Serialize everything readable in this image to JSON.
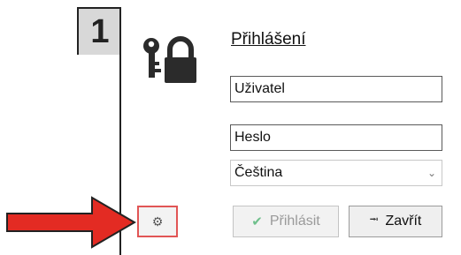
{
  "step_badge": "1",
  "dialog": {
    "title": "Přihlášení",
    "username_placeholder": "Uživatel",
    "password_placeholder": "Heslo",
    "language_selected": "Čeština",
    "login_label": "Přihlásit",
    "close_label": "Zavřít"
  },
  "icons": {
    "header": "key-lock-icon",
    "settings": "gear-icon",
    "login": "checkmark-icon",
    "close": "exit-door-icon",
    "dropdown": "chevron-down-icon",
    "annotation": "red-arrow"
  },
  "colors": {
    "annotation_arrow": "#e32b23",
    "settings_highlight": "#e15555",
    "login_check": "#6fc08c"
  }
}
